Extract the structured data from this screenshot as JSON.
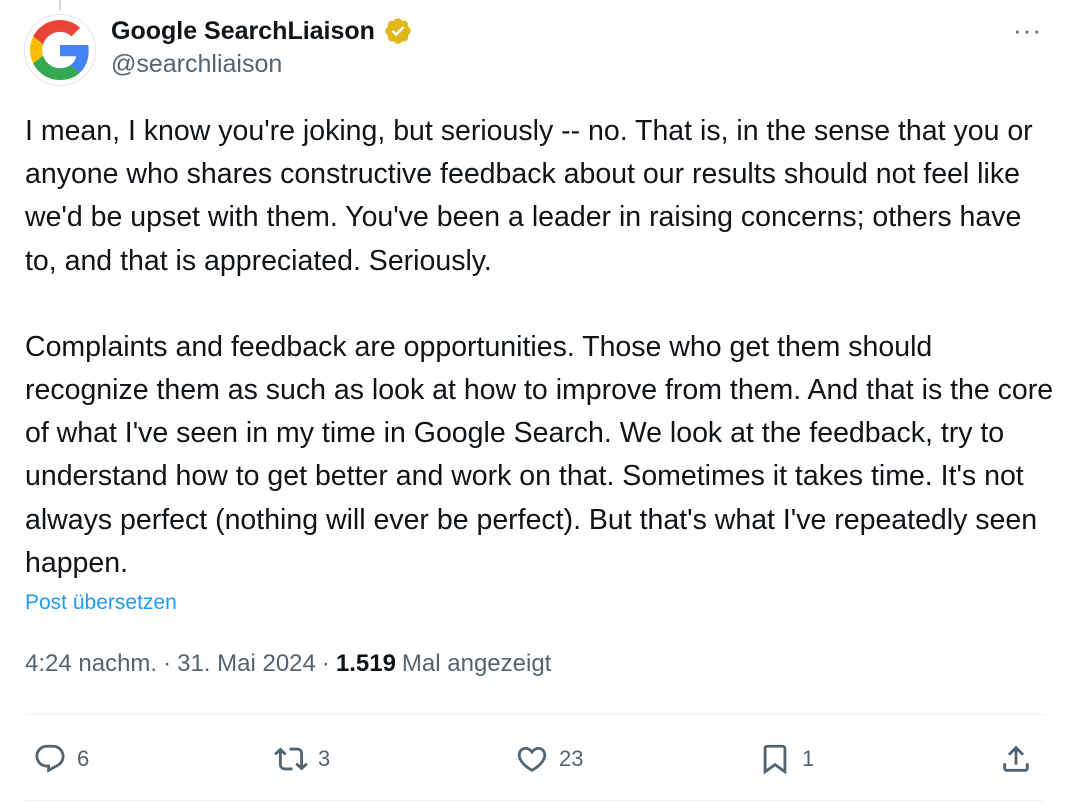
{
  "author": {
    "name": "Google SearchLiaison",
    "handle": "@searchliaison"
  },
  "post": {
    "paragraph_1": "I mean, I know you're joking, but seriously -- no. That is, in the sense that you or anyone who shares constructive feedback about our results should not feel like we'd be upset with them. You've been a leader in raising concerns; others have to, and that is appreciated. Seriously.",
    "paragraph_2": "Complaints and feedback are opportunities. Those who get them should recognize them as such as look at how to improve from them. And that is the core of what I've seen in my time in Google Search. We look at the feedback, try to understand how to get better and work on that. Sometimes it takes time. It's not always perfect (nothing will ever be perfect). But that's what I've repeatedly seen happen.",
    "translate_label": "Post übersetzen"
  },
  "meta": {
    "time": "4:24 nachm.",
    "date": "31. Mai 2024",
    "separator": "·",
    "views_count": "1.519",
    "views_label": "Mal angezeigt"
  },
  "actions": {
    "replies": "6",
    "reposts": "3",
    "likes": "23",
    "bookmarks": "1"
  },
  "more_label": "···",
  "colors": {
    "text": "#0f1419",
    "muted": "#536471",
    "link": "#1d9bf0",
    "verified_gold": "#e2b719"
  },
  "icons": [
    "google-logo-icon",
    "verified-badge-icon",
    "more-icon",
    "reply-icon",
    "repost-icon",
    "like-icon",
    "bookmark-icon",
    "share-icon"
  ]
}
